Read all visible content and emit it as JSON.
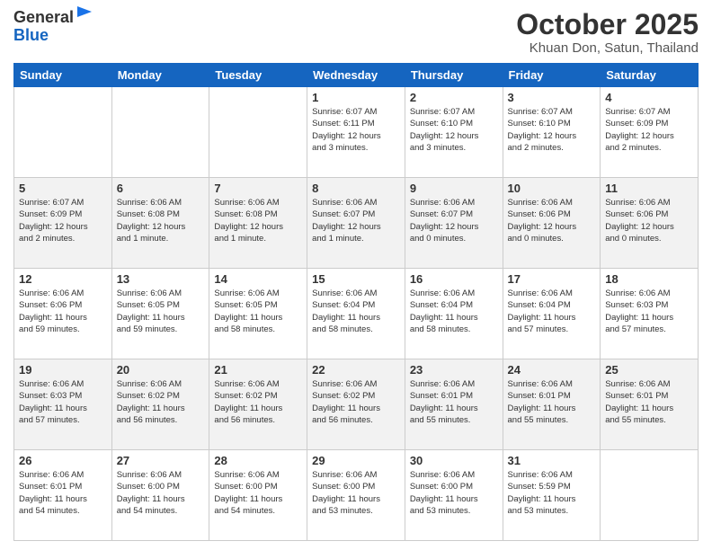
{
  "header": {
    "logo_line1": "General",
    "logo_line2": "Blue",
    "month": "October 2025",
    "location": "Khuan Don, Satun, Thailand"
  },
  "weekdays": [
    "Sunday",
    "Monday",
    "Tuesday",
    "Wednesday",
    "Thursday",
    "Friday",
    "Saturday"
  ],
  "weeks": [
    [
      {
        "day": "",
        "info": ""
      },
      {
        "day": "",
        "info": ""
      },
      {
        "day": "",
        "info": ""
      },
      {
        "day": "1",
        "info": "Sunrise: 6:07 AM\nSunset: 6:11 PM\nDaylight: 12 hours\nand 3 minutes."
      },
      {
        "day": "2",
        "info": "Sunrise: 6:07 AM\nSunset: 6:10 PM\nDaylight: 12 hours\nand 3 minutes."
      },
      {
        "day": "3",
        "info": "Sunrise: 6:07 AM\nSunset: 6:10 PM\nDaylight: 12 hours\nand 2 minutes."
      },
      {
        "day": "4",
        "info": "Sunrise: 6:07 AM\nSunset: 6:09 PM\nDaylight: 12 hours\nand 2 minutes."
      }
    ],
    [
      {
        "day": "5",
        "info": "Sunrise: 6:07 AM\nSunset: 6:09 PM\nDaylight: 12 hours\nand 2 minutes."
      },
      {
        "day": "6",
        "info": "Sunrise: 6:06 AM\nSunset: 6:08 PM\nDaylight: 12 hours\nand 1 minute."
      },
      {
        "day": "7",
        "info": "Sunrise: 6:06 AM\nSunset: 6:08 PM\nDaylight: 12 hours\nand 1 minute."
      },
      {
        "day": "8",
        "info": "Sunrise: 6:06 AM\nSunset: 6:07 PM\nDaylight: 12 hours\nand 1 minute."
      },
      {
        "day": "9",
        "info": "Sunrise: 6:06 AM\nSunset: 6:07 PM\nDaylight: 12 hours\nand 0 minutes."
      },
      {
        "day": "10",
        "info": "Sunrise: 6:06 AM\nSunset: 6:06 PM\nDaylight: 12 hours\nand 0 minutes."
      },
      {
        "day": "11",
        "info": "Sunrise: 6:06 AM\nSunset: 6:06 PM\nDaylight: 12 hours\nand 0 minutes."
      }
    ],
    [
      {
        "day": "12",
        "info": "Sunrise: 6:06 AM\nSunset: 6:06 PM\nDaylight: 11 hours\nand 59 minutes."
      },
      {
        "day": "13",
        "info": "Sunrise: 6:06 AM\nSunset: 6:05 PM\nDaylight: 11 hours\nand 59 minutes."
      },
      {
        "day": "14",
        "info": "Sunrise: 6:06 AM\nSunset: 6:05 PM\nDaylight: 11 hours\nand 58 minutes."
      },
      {
        "day": "15",
        "info": "Sunrise: 6:06 AM\nSunset: 6:04 PM\nDaylight: 11 hours\nand 58 minutes."
      },
      {
        "day": "16",
        "info": "Sunrise: 6:06 AM\nSunset: 6:04 PM\nDaylight: 11 hours\nand 58 minutes."
      },
      {
        "day": "17",
        "info": "Sunrise: 6:06 AM\nSunset: 6:04 PM\nDaylight: 11 hours\nand 57 minutes."
      },
      {
        "day": "18",
        "info": "Sunrise: 6:06 AM\nSunset: 6:03 PM\nDaylight: 11 hours\nand 57 minutes."
      }
    ],
    [
      {
        "day": "19",
        "info": "Sunrise: 6:06 AM\nSunset: 6:03 PM\nDaylight: 11 hours\nand 57 minutes."
      },
      {
        "day": "20",
        "info": "Sunrise: 6:06 AM\nSunset: 6:02 PM\nDaylight: 11 hours\nand 56 minutes."
      },
      {
        "day": "21",
        "info": "Sunrise: 6:06 AM\nSunset: 6:02 PM\nDaylight: 11 hours\nand 56 minutes."
      },
      {
        "day": "22",
        "info": "Sunrise: 6:06 AM\nSunset: 6:02 PM\nDaylight: 11 hours\nand 56 minutes."
      },
      {
        "day": "23",
        "info": "Sunrise: 6:06 AM\nSunset: 6:01 PM\nDaylight: 11 hours\nand 55 minutes."
      },
      {
        "day": "24",
        "info": "Sunrise: 6:06 AM\nSunset: 6:01 PM\nDaylight: 11 hours\nand 55 minutes."
      },
      {
        "day": "25",
        "info": "Sunrise: 6:06 AM\nSunset: 6:01 PM\nDaylight: 11 hours\nand 55 minutes."
      }
    ],
    [
      {
        "day": "26",
        "info": "Sunrise: 6:06 AM\nSunset: 6:01 PM\nDaylight: 11 hours\nand 54 minutes."
      },
      {
        "day": "27",
        "info": "Sunrise: 6:06 AM\nSunset: 6:00 PM\nDaylight: 11 hours\nand 54 minutes."
      },
      {
        "day": "28",
        "info": "Sunrise: 6:06 AM\nSunset: 6:00 PM\nDaylight: 11 hours\nand 54 minutes."
      },
      {
        "day": "29",
        "info": "Sunrise: 6:06 AM\nSunset: 6:00 PM\nDaylight: 11 hours\nand 53 minutes."
      },
      {
        "day": "30",
        "info": "Sunrise: 6:06 AM\nSunset: 6:00 PM\nDaylight: 11 hours\nand 53 minutes."
      },
      {
        "day": "31",
        "info": "Sunrise: 6:06 AM\nSunset: 5:59 PM\nDaylight: 11 hours\nand 53 minutes."
      },
      {
        "day": "",
        "info": ""
      }
    ]
  ]
}
